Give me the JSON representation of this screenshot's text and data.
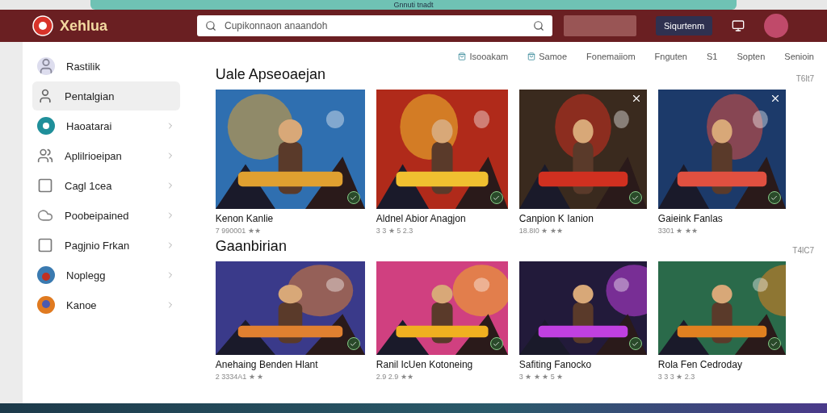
{
  "browser": {
    "tab_title": "Gnnuti tnadt"
  },
  "header": {
    "logo": "Xehlua",
    "search": {
      "placeholder": "Cupikonnaon anaandoh"
    },
    "button": "Siqurtenm"
  },
  "sidebar": {
    "items": [
      {
        "label": "Rastilik",
        "kind": "avatar",
        "selected": false,
        "chevron": false
      },
      {
        "label": "Pentalgian",
        "kind": "user",
        "selected": true,
        "chevron": false
      },
      {
        "label": "Haoatarai",
        "kind": "disc",
        "selected": false,
        "chevron": true
      },
      {
        "label": "Aplilrioeipan",
        "kind": "people",
        "selected": false,
        "chevron": true
      },
      {
        "label": "Cagl 1cea",
        "kind": "square",
        "selected": false,
        "chevron": true
      },
      {
        "label": "Poobeipained",
        "kind": "cloud",
        "selected": false,
        "chevron": true
      },
      {
        "label": "Pagjnio Frkan",
        "kind": "square",
        "selected": false,
        "chevron": true
      },
      {
        "label": "Noplegg",
        "kind": "game",
        "selected": false,
        "chevron": true
      },
      {
        "label": "Kanoe",
        "kind": "game",
        "selected": false,
        "chevron": true
      }
    ]
  },
  "filters": [
    {
      "label": "Isooakam",
      "icon": true
    },
    {
      "label": "Samoe",
      "icon": true
    },
    {
      "label": "Fonemaiiom",
      "icon": false
    },
    {
      "label": "Fnguten",
      "icon": false
    },
    {
      "label": "S1",
      "icon": false
    },
    {
      "label": "Sopten",
      "icon": false
    },
    {
      "label": "Senioin",
      "icon": false
    }
  ],
  "sections": [
    {
      "title": "Uale Apseoaejan",
      "more": "T6lt7",
      "games": [
        {
          "title": "Kenon Kanlie",
          "meta": "7 990001 ★★",
          "close": false,
          "rated": true
        },
        {
          "title": "Aldnel Abior Anagjon",
          "meta": "3 3 ★ 5 2.3",
          "close": false,
          "rated": true
        },
        {
          "title": "Canpion K Ianion",
          "meta": "18.8I0 ★ ★★",
          "close": true,
          "rated": true
        },
        {
          "title": "Gaieink Fanlas",
          "meta": "3301 ★ ★★",
          "close": true,
          "rated": true
        }
      ]
    },
    {
      "title": "Gaanbirian",
      "more": "T4lC7",
      "games": [
        {
          "title": "Anehaing Benden Hlant",
          "meta": "2 3334A1 ★ ★",
          "close": false,
          "rated": true
        },
        {
          "title": "Ranil IcUen Kotoneing",
          "meta": "2.9 2.9 ★★",
          "close": false,
          "rated": true
        },
        {
          "title": "Safiting Fanocko",
          "meta": "3 ★ ★ ★ 5 ★",
          "close": false,
          "rated": true
        },
        {
          "title": "Rola Fen Cedroday",
          "meta": "3 3 3 ★ 2.3",
          "close": false,
          "rated": true
        }
      ]
    }
  ]
}
